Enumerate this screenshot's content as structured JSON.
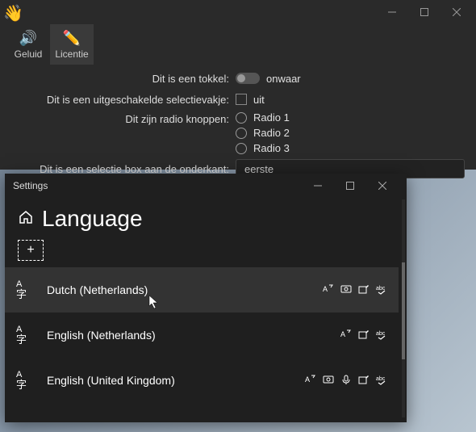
{
  "topWindow": {
    "tabs": {
      "sound": {
        "label": "Geluid"
      },
      "license": {
        "label": "Licentie"
      }
    },
    "form": {
      "toggleLabel": "Dit is een tokkel:",
      "toggleValue": "onwaar",
      "checkboxLabel": "Dit is een uitgeschakelde selectievakje:",
      "checkboxValue": "uit",
      "radioLabel": "Dit zijn radio knoppen:",
      "radios": [
        "Radio 1",
        "Radio 2",
        "Radio 3"
      ],
      "selectLabel": "Dit is een selectie box aan de onderkant:",
      "selectValue": "eerste"
    }
  },
  "settings": {
    "title": "Settings",
    "heading": "Language",
    "languages": [
      {
        "name": "Dutch (Netherlands)"
      },
      {
        "name": "English (Netherlands)"
      },
      {
        "name": "English (United Kingdom)"
      }
    ]
  }
}
